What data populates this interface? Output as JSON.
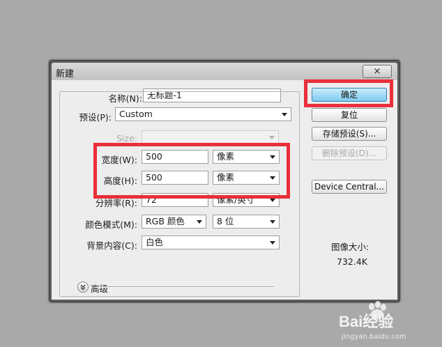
{
  "dialog": {
    "title": "新建",
    "close_glyph": "×"
  },
  "form": {
    "name": {
      "label": "名称(N):",
      "value": "无标题-1"
    },
    "preset": {
      "label": "预设(P):",
      "value": "Custom"
    },
    "size": {
      "label": "Size:",
      "value": ""
    },
    "width": {
      "label": "宽度(W):",
      "value": "500",
      "unit": "像素"
    },
    "height": {
      "label": "高度(H):",
      "value": "500",
      "unit": "像素"
    },
    "resolution": {
      "label": "分辨率(R):",
      "value": "72",
      "unit": "像素/英寸"
    },
    "color_mode": {
      "label": "颜色模式(M):",
      "value": "RGB 颜色",
      "depth": "8 位"
    },
    "background": {
      "label": "背景内容(C):",
      "value": "白色"
    },
    "advanced": {
      "label": "高级"
    }
  },
  "buttons": {
    "ok": "确定",
    "reset": "复位",
    "save_preset": "存储预设(S)...",
    "delete_preset": "删除预设(D)...",
    "device_central": "Device Central..."
  },
  "image_size": {
    "label": "图像大小:",
    "value": "732.4K"
  },
  "watermark": {
    "brand": "Bai经验",
    "url": "jingyan.baidu.com"
  },
  "colors": {
    "highlight": "#e8303a",
    "primary_button": "#7fcbf0"
  }
}
